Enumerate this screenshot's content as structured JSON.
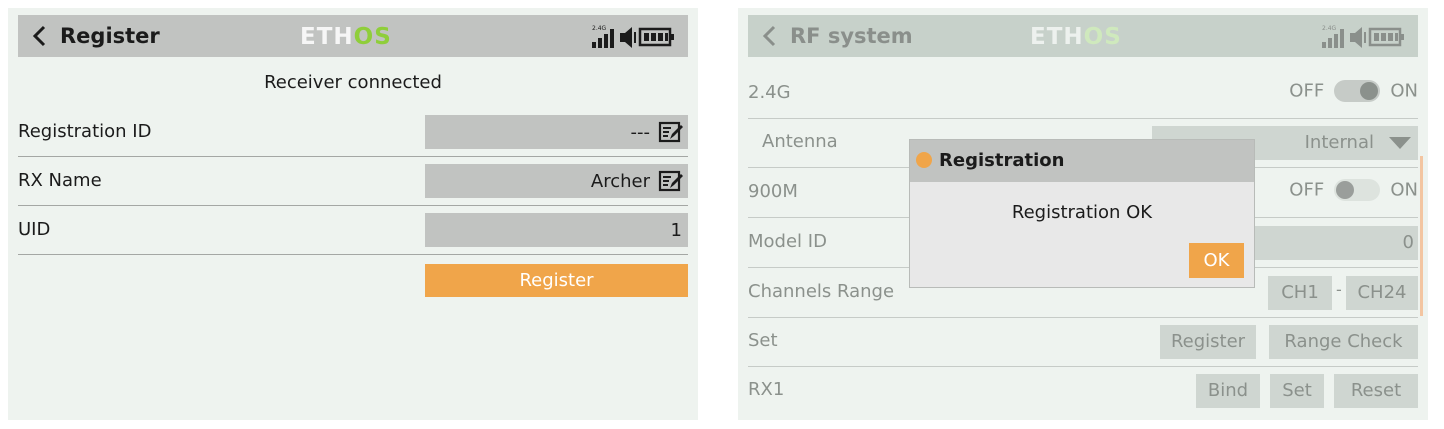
{
  "left": {
    "title": "Register",
    "logo": {
      "part1": "ETH",
      "part2": "OS"
    },
    "status_text": "Receiver connected",
    "rows": [
      {
        "label": "Registration ID",
        "value": "---"
      },
      {
        "label": "RX Name",
        "value": "Archer"
      },
      {
        "label": "UID",
        "value": "1"
      }
    ],
    "register_button": "Register",
    "status_badge": "2.4G"
  },
  "right": {
    "title": "RF system",
    "logo": {
      "part1": "ETH",
      "part2": "OS"
    },
    "status_badge": "2.4G",
    "rows": {
      "r24g": {
        "label": "2.4G",
        "off": "OFF",
        "on": "ON"
      },
      "antenna": {
        "label": "Antenna",
        "value": "Internal"
      },
      "m900": {
        "label": "900M",
        "off": "OFF",
        "on": "ON"
      },
      "model_id": {
        "label": "Model ID",
        "value": "0"
      },
      "channels": {
        "label": "Channels Range",
        "from": "CH1",
        "sep": "-",
        "to": "CH24"
      },
      "set": {
        "label": "Set",
        "register": "Register",
        "range_check": "Range Check"
      },
      "rx1": {
        "label": "RX1",
        "bind": "Bind",
        "set": "Set",
        "reset": "Reset"
      }
    },
    "dialog": {
      "title": "Registration",
      "message": "Registration OK",
      "ok": "OK"
    }
  },
  "colors": {
    "accent": "#f0a54a",
    "logo_green": "#8fce3a",
    "header_bg": "#c1c3c1",
    "screen_bg": "#eef3ef"
  }
}
